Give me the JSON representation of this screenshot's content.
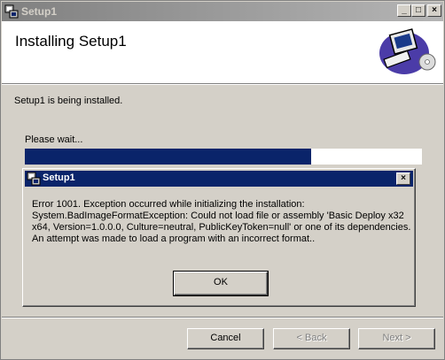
{
  "window": {
    "title": "Setup1",
    "buttons": {
      "minimize": "_",
      "maximize": "□",
      "close": "×"
    }
  },
  "header": {
    "title": "Installing Setup1",
    "icon": "computer-setup-icon"
  },
  "status_text": "Setup1 is being installed.",
  "wait_text": "Please wait...",
  "progress": {
    "percent": 72
  },
  "footer": {
    "cancel_label": "Cancel",
    "back_label": "< Back",
    "next_label": "Next >"
  },
  "dialog": {
    "title": "Setup1",
    "close": "×",
    "message": "Error 1001. Exception occurred while initializing the installation: System.BadImageFormatException: Could not load file or assembly 'Basic Deploy x32 x64, Version=1.0.0.0, Culture=neutral, PublicKeyToken=null' or one of its dependencies. An attempt was made to load a program with an incorrect format..",
    "ok_label": "OK"
  },
  "colors": {
    "face": "#d4d0c8",
    "active_title": "#0a246a",
    "progress_fill": "#0a246a"
  }
}
